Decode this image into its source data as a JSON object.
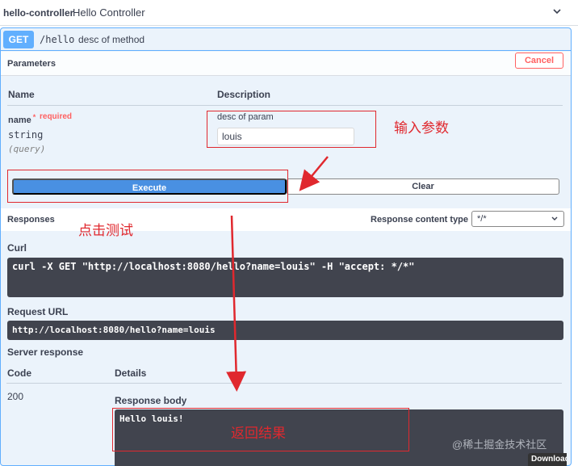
{
  "tag": {
    "name": "hello-controller",
    "description": "Hello Controller"
  },
  "operation": {
    "method": "GET",
    "path": "/hello",
    "summary": "desc of method"
  },
  "parameters": {
    "title": "Parameters",
    "cancel_label": "Cancel",
    "col_name": "Name",
    "col_description": "Description",
    "param": {
      "name": "name",
      "required_star": "*",
      "required_text": "required",
      "type": "string",
      "in": "(query)",
      "description": "desc of param",
      "value": "louis"
    }
  },
  "buttons": {
    "execute": "Execute",
    "clear": "Clear"
  },
  "responses": {
    "title": "Responses",
    "content_type_label": "Response content type",
    "content_type_value": "*/*",
    "curl_label": "Curl",
    "curl": "curl -X GET \"http://localhost:8080/hello?name=louis\" -H \"accept: */*\"",
    "request_url_label": "Request URL",
    "request_url": "http://localhost:8080/hello?name=louis",
    "server_response_label": "Server response",
    "col_code": "Code",
    "col_details": "Details",
    "code": "200",
    "response_body_label": "Response body",
    "response_body": "Hello louis!",
    "download_label": "Download"
  },
  "annotations": {
    "input_params": "输入参数",
    "click_test": "点击测试",
    "return_result": "返回结果",
    "color": "#e0282e"
  },
  "watermark": "@稀土掘金技术社区",
  "colors": {
    "get": "#61affe",
    "execute": "#4990e2",
    "cancel": "#ff6060",
    "code_bg": "#41444e"
  }
}
